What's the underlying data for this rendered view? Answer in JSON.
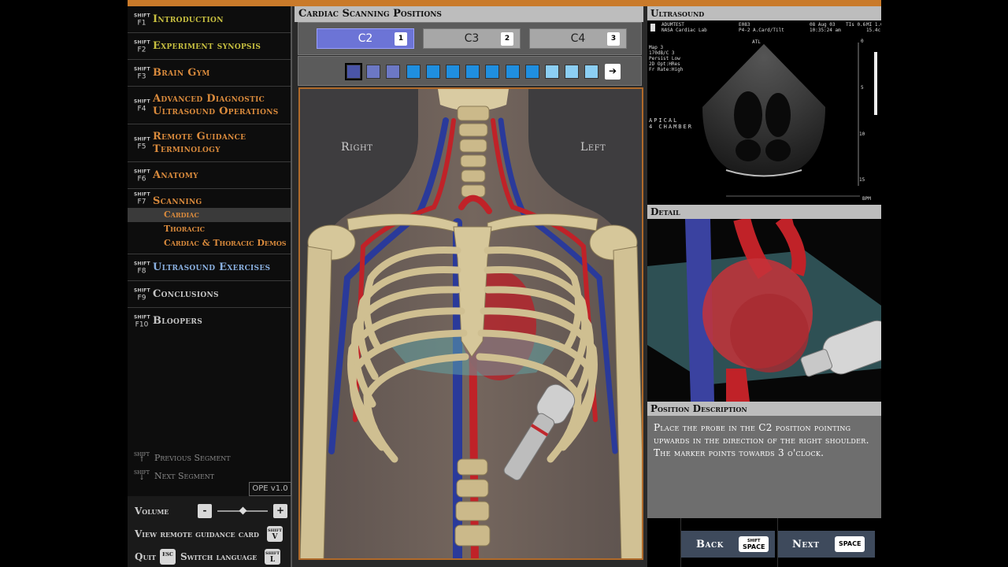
{
  "sidebar": {
    "items": [
      {
        "shift": "SHIFT",
        "key": "F1",
        "label": "Introduction",
        "color": "#c8c040"
      },
      {
        "shift": "SHIFT",
        "key": "F2",
        "label": "Experiment synopsis",
        "color": "#c8c040"
      },
      {
        "shift": "SHIFT",
        "key": "F3",
        "label": "Brain Gym",
        "color": "#d98a3c"
      },
      {
        "shift": "SHIFT",
        "key": "F4",
        "label": "Advanced Diagnostic Ultrasound Operations",
        "color": "#d98a3c"
      },
      {
        "shift": "SHIFT",
        "key": "F5",
        "label": "Remote Guidance Terminology",
        "color": "#d98a3c"
      },
      {
        "shift": "SHIFT",
        "key": "F6",
        "label": "Anatomy",
        "color": "#d98a3c"
      },
      {
        "shift": "SHIFT",
        "key": "F7",
        "label": "Scanning",
        "color": "#d98a3c"
      },
      {
        "shift": "SHIFT",
        "key": "F8",
        "label": "Ultrasound Exercises",
        "color": "#8ab0e0"
      },
      {
        "shift": "SHIFT",
        "key": "F9",
        "label": "Conclusions",
        "color": "#c6c6c6"
      },
      {
        "shift": "SHIFT",
        "key": "F10",
        "label": "Bloopers",
        "color": "#c6c6c6"
      }
    ],
    "scanning_sub": [
      "Cardiac",
      "Thoracic",
      "Cardiac & Thoracic Demos"
    ],
    "prev_segment": {
      "key": "SHIFT",
      "arrow": "↑",
      "label": "Previous Segment"
    },
    "next_segment": {
      "key": "SHIFT",
      "arrow": "↓",
      "label": "Next Segment"
    },
    "version": "OPE v1.0"
  },
  "controls": {
    "volume_label": "Volume",
    "volume_minus": "-",
    "volume_plus": "+",
    "volume_level": 0.5,
    "remote_card_label": "View remote guidance card",
    "remote_card_key": {
      "shift": "SHIFT",
      "letter": "V"
    },
    "quit_label": "Quit",
    "quit_key": "ESC",
    "lang_label": "Switch language",
    "lang_key": {
      "shift": "SHIFT",
      "letter": "L"
    }
  },
  "scan": {
    "title": "Cardiac Scanning Positions",
    "positions": [
      {
        "label": "C2",
        "num": "1"
      },
      {
        "label": "C3",
        "num": "2"
      },
      {
        "label": "C4",
        "num": "3"
      }
    ],
    "squares": [
      "#4a55a8",
      "#6c78c4",
      "#6c78c4",
      "#1f8fe0",
      "#1f8fe0",
      "#1f8fe0",
      "#1f8fe0",
      "#1f8fe0",
      "#1f8fe0",
      "#1f8fe0",
      "#8ccff4",
      "#8ccff4",
      "#8ccff4"
    ],
    "arrow": "➔",
    "right_label": "Right",
    "left_label": "Left"
  },
  "ultrasound": {
    "title": "Ultrasound",
    "info_1": "ADUMTEST\nNASA Cardiac Lab",
    "info_2": "E083\nP4-2 A.Card/Tilt",
    "info_3": "08 Aug 03\n10:35:24 am",
    "info_4": "TIs 0.6",
    "info_5": "MI 1.0\n15.4c",
    "params": "Map 3\n170dB/C 3\nPersist Low\n2D Opt:HRes\nFr Rate:High",
    "view_label": "APICAL\n4 CHAMBER",
    "marker": "ATL",
    "depth_scale": [
      "0",
      "5",
      "10",
      "15"
    ],
    "bpm": "BPM"
  },
  "detail": {
    "title": "Detail"
  },
  "description": {
    "title": "Position Description",
    "text": "Place the probe in the C2 position pointing upwards in the direction of the right shoulder. The marker points towards 3 o'clock."
  },
  "nav": {
    "back_label": "Back",
    "back_key": {
      "shift": "SHIFT",
      "key": "SPACE"
    },
    "next_label": "Next",
    "next_key": "SPACE"
  }
}
